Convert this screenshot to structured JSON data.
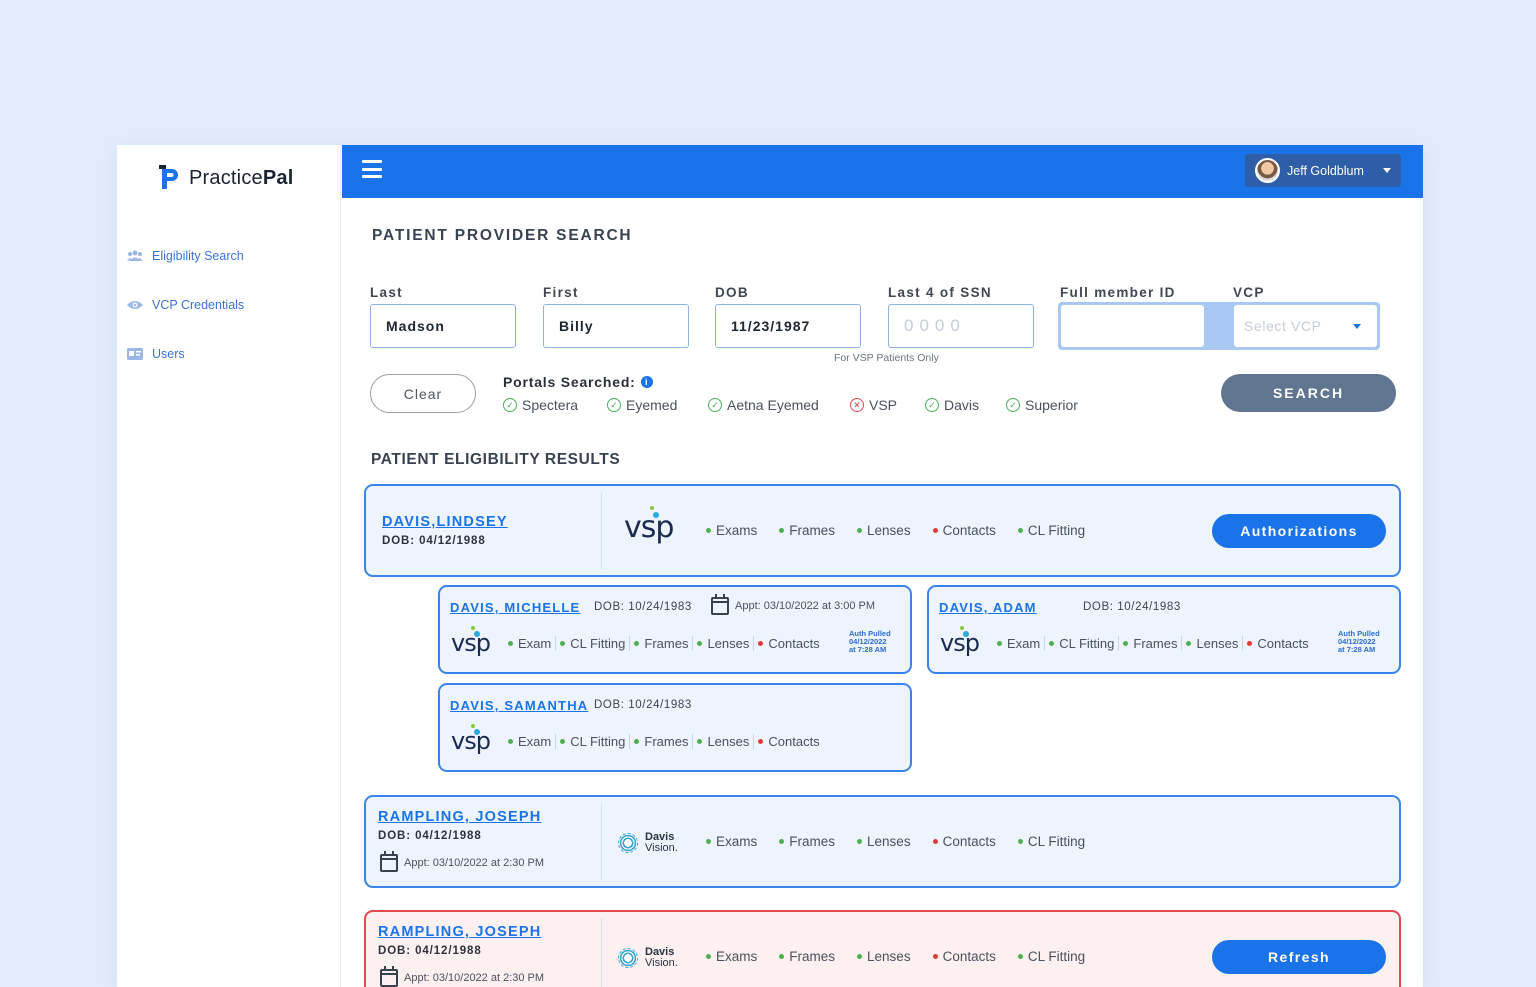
{
  "brand": {
    "name_light": "Practice",
    "name_bold": "Pal"
  },
  "sidebar": {
    "items": [
      {
        "label": "Eligibility Search",
        "icon": "users-icon"
      },
      {
        "label": "VCP Credentials",
        "icon": "eye-icon"
      },
      {
        "label": "Users",
        "icon": "id-card-icon"
      }
    ]
  },
  "topbar": {
    "user_name": "Jeff Goldblum"
  },
  "search": {
    "title": "PATIENT PROVIDER SEARCH",
    "labels": {
      "last": "Last",
      "first": "First",
      "dob": "DOB",
      "ssn": "Last 4 of SSN",
      "member_id": "Full member ID",
      "vcp": "VCP"
    },
    "values": {
      "last": "Madson",
      "first": "Billy",
      "dob": "11/23/1987",
      "ssn": "",
      "member_id": ""
    },
    "placeholders": {
      "ssn": "0000",
      "vcp": "Select VCP"
    },
    "hint": "For VSP Patients Only",
    "clear_label": "Clear",
    "search_label": "SEARCH",
    "portals_label": "Portals Searched:",
    "portals": [
      {
        "name": "Spectera",
        "status": "ok"
      },
      {
        "name": "Eyemed",
        "status": "ok"
      },
      {
        "name": "Aetna Eyemed",
        "status": "ok"
      },
      {
        "name": "VSP",
        "status": "error"
      },
      {
        "name": "Davis",
        "status": "ok"
      },
      {
        "name": "Superior",
        "status": "ok"
      }
    ]
  },
  "results": {
    "title": "PATIENT ELIGIBILITY RESULTS",
    "primary": {
      "name": "DAVIS,LINDSEY",
      "dob": "DOB: 04/12/1988",
      "logo": "vsp",
      "tags": [
        "Exams",
        "Frames",
        "Lenses",
        "Contacts",
        "CL Fitting"
      ],
      "button": "Authorizations"
    },
    "dependents": [
      {
        "name": "DAVIS, MICHELLE",
        "dob": "DOB: 10/24/1983",
        "appt": "Appt: 03/10/2022 at 3:00 PM",
        "tags": [
          "Exam",
          "CL Fitting",
          "Frames",
          "Lenses",
          "Contacts"
        ],
        "auth": [
          "Auth Pulled",
          "04/12/2022",
          "at 7:28 AM"
        ]
      },
      {
        "name": "DAVIS, ADAM",
        "dob": "DOB: 10/24/1983",
        "tags": [
          "Exam",
          "CL Fitting",
          "Frames",
          "Lenses",
          "Contacts"
        ],
        "auth": [
          "Auth Pulled",
          "04/12/2022",
          "at 7:28 AM"
        ]
      },
      {
        "name": "DAVIS, SAMANTHA",
        "dob": "DOB: 10/24/1983",
        "tags": [
          "Exam",
          "CL Fitting",
          "Frames",
          "Lenses",
          "Contacts"
        ]
      }
    ],
    "davis_cards": [
      {
        "name": "RAMPLING, JOSEPH",
        "dob": "DOB: 04/12/1988",
        "appt": "Appt: 03/10/2022 at 2:30 PM",
        "logo_line1": "Davis",
        "logo_line2": "Vision.",
        "tags": [
          "Exams",
          "Frames",
          "Lenses",
          "Contacts",
          "CL Fitting"
        ]
      },
      {
        "name": "RAMPLING, JOSEPH",
        "dob": "DOB: 04/12/1988",
        "appt": "Appt: 03/10/2022 at 2:30 PM",
        "logo_line1": "Davis",
        "logo_line2": "Vision.",
        "tags": [
          "Exams",
          "Frames",
          "Lenses",
          "Contacts",
          "CL Fitting"
        ],
        "button": "Refresh"
      }
    ],
    "tag_status": {
      "Contacts": "red"
    }
  },
  "colors": {
    "primary": "#1a73e8",
    "success": "#4caf50",
    "danger": "#e53935",
    "search_button": "#5f7590"
  }
}
